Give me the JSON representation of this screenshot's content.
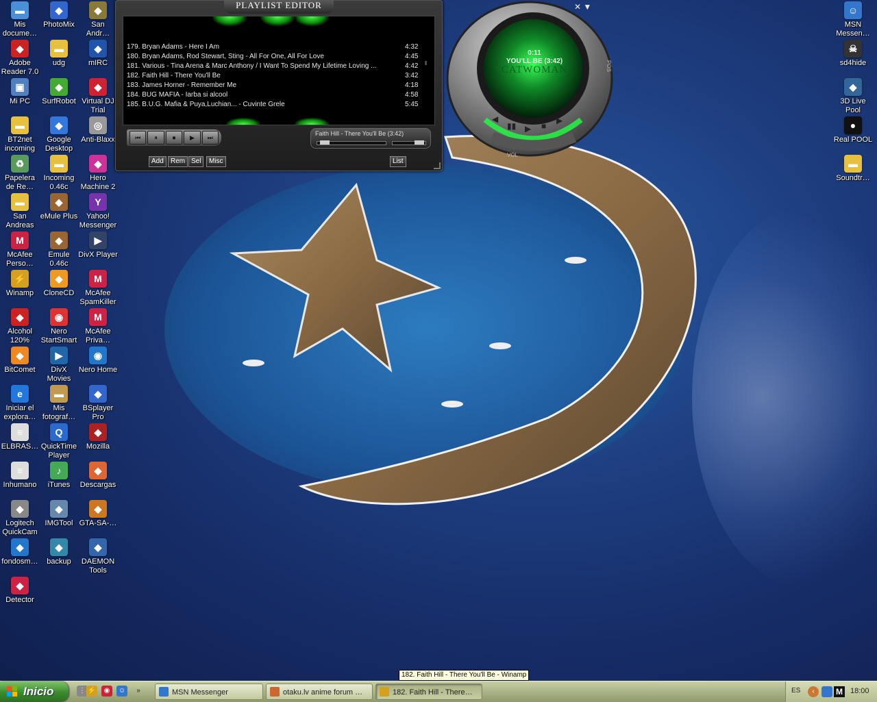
{
  "desktop_icons_left": [
    {
      "label": "Mis documentos",
      "display": "Mis\ndocume…",
      "icon": "folder-icon",
      "color": "#4a90d9"
    },
    {
      "label": "PhotoMix",
      "display": "PhotoMix",
      "icon": "photomix-icon",
      "color": "#3366cc"
    },
    {
      "label": "San Andreas",
      "display": "San\nAndr…",
      "icon": "san-andreas-icon",
      "color": "#8a7a3a"
    },
    {
      "label": "Adobe Reader 7.0",
      "display": "Adobe\nReader 7.0",
      "icon": "adobe-reader-icon",
      "color": "#cc2222"
    },
    {
      "label": "udg",
      "display": "udg",
      "icon": "folder-icon",
      "color": "#e8c040"
    },
    {
      "label": "mIRC",
      "display": "mIRC",
      "icon": "mirc-icon",
      "color": "#2255aa"
    },
    {
      "label": "Mi PC",
      "display": "Mi PC",
      "icon": "computer-icon",
      "color": "#5080c0"
    },
    {
      "label": "SurfRobot",
      "display": "SurfRobot",
      "icon": "surfrobot-icon",
      "color": "#44aa33"
    },
    {
      "label": "Virtual DJ Trial",
      "display": "Virtual DJ\nTrial",
      "icon": "virtual-dj-icon",
      "color": "#cc2233"
    },
    {
      "label": "BT2net incoming",
      "display": "BT2net\nincoming",
      "icon": "folder-icon",
      "color": "#e8c040"
    },
    {
      "label": "Google Desktop",
      "display": "Google\nDesktop",
      "icon": "google-desktop-icon",
      "color": "#3377dd"
    },
    {
      "label": "Anti-Blaxx",
      "display": "Anti-Blaxx",
      "icon": "cd-icon",
      "color": "#999999"
    },
    {
      "label": "Papelera de Reciclaje",
      "display": "Papelera\nde Re…",
      "icon": "recycle-bin-icon",
      "color": "#5a9a5a"
    },
    {
      "label": "Incoming 0.46c",
      "display": "Incoming\n0.46c",
      "icon": "folder-icon",
      "color": "#e8c040"
    },
    {
      "label": "Hero Machine 2",
      "display": "Hero\nMachine 2",
      "icon": "hero-machine-icon",
      "color": "#cc3399"
    },
    {
      "label": "San Andreas",
      "display": "San\nAndreas",
      "icon": "folder-icon",
      "color": "#e8c040"
    },
    {
      "label": "eMule Plus",
      "display": "eMule Plus",
      "icon": "emule-icon",
      "color": "#996633"
    },
    {
      "label": "Yahoo! Messenger",
      "display": "Yahoo!\nMessenger",
      "icon": "yahoo-messenger-icon",
      "color": "#7733aa"
    },
    {
      "label": "McAfee Personal",
      "display": "McAfee\nPerso…",
      "icon": "mcafee-icon",
      "color": "#cc2244"
    },
    {
      "label": "Emule 0.46c",
      "display": "Emule\n0.46c",
      "icon": "emule-icon",
      "color": "#996633"
    },
    {
      "label": "DivX Player",
      "display": "DivX Player",
      "icon": "divx-icon",
      "color": "#334466"
    },
    {
      "label": "Winamp",
      "display": "Winamp",
      "icon": "winamp-icon",
      "color": "#d4a020"
    },
    {
      "label": "CloneCD",
      "display": "CloneCD",
      "icon": "clonecd-icon",
      "color": "#ee9922"
    },
    {
      "label": "McAfee SpamKiller",
      "display": "McAfee\nSpamKiller",
      "icon": "mcafee-icon",
      "color": "#cc2244"
    },
    {
      "label": "Alcohol 120%",
      "display": "Alcohol\n120%",
      "icon": "alcohol-icon",
      "color": "#cc2222"
    },
    {
      "label": "Nero StartSmart",
      "display": "Nero\nStartSmart",
      "icon": "nero-icon",
      "color": "#dd3333"
    },
    {
      "label": "McAfee Privacy",
      "display": "McAfee\nPriva…",
      "icon": "mcafee-icon",
      "color": "#cc2244"
    },
    {
      "label": "BitComet",
      "display": "BitComet",
      "icon": "bitcomet-icon",
      "color": "#ee8822"
    },
    {
      "label": "DivX Movies",
      "display": "DivX\nMovies",
      "icon": "divx-icon",
      "color": "#2266aa"
    },
    {
      "label": "Nero Home",
      "display": "Nero Home",
      "icon": "nero-icon",
      "color": "#2277cc"
    },
    {
      "label": "Iniciar el explorador",
      "display": "Iniciar el\nexplora…",
      "icon": "internet-explorer-icon",
      "color": "#2277dd"
    },
    {
      "label": "Mis fotografías",
      "display": "Mis\nfotograf…",
      "icon": "folder-icon",
      "color": "#c09a50"
    },
    {
      "label": "BSplayer Pro",
      "display": "BSplayer\nPro",
      "icon": "bsplayer-icon",
      "color": "#3366cc"
    },
    {
      "label": "ELBRAS…",
      "display": "ELBRAS…",
      "icon": "document-icon",
      "color": "#dddddd"
    },
    {
      "label": "QuickTime Player",
      "display": "QuickTime\nPlayer",
      "icon": "quicktime-icon",
      "color": "#2a6acc"
    },
    {
      "label": "Mozilla",
      "display": "Mozilla",
      "icon": "mozilla-icon",
      "color": "#aa2222"
    },
    {
      "label": "Inhumano",
      "display": "Inhumano",
      "icon": "document-icon",
      "color": "#dddddd"
    },
    {
      "label": "iTunes",
      "display": "iTunes",
      "icon": "itunes-icon",
      "color": "#44aa55"
    },
    {
      "label": "Descargas",
      "display": "Descargas",
      "icon": "descargas-icon",
      "color": "#dd6633"
    },
    {
      "label": "Logitech QuickCam",
      "display": "Logitech\nQuickCam",
      "icon": "webcam-icon",
      "color": "#888888"
    },
    {
      "label": "IMGTool",
      "display": "IMGTool",
      "icon": "imgtool-icon",
      "color": "#6688aa"
    },
    {
      "label": "GTA-SA-…",
      "display": "GTA-SA-…",
      "icon": "gta-icon",
      "color": "#cc7722"
    },
    {
      "label": "fondosm…",
      "display": "fondosm…",
      "icon": "image-file-icon",
      "color": "#2277cc"
    },
    {
      "label": "backup",
      "display": "backup",
      "icon": "backup-icon",
      "color": "#3388aa"
    },
    {
      "label": "DAEMON Tools",
      "display": "DAEMON\nTools",
      "icon": "daemon-tools-icon",
      "color": "#3366aa"
    },
    {
      "label": "Detector",
      "display": "Detector",
      "icon": "detector-icon",
      "color": "#cc2244"
    }
  ],
  "desktop_icons_right": [
    {
      "label": "MSN Messenger",
      "display": "MSN\nMessen…",
      "icon": "msn-messenger-icon",
      "color": "#3377cc"
    },
    {
      "label": "sd4hide",
      "display": "sd4hide",
      "icon": "skull-icon",
      "color": "#333333"
    },
    {
      "label": "3D Live Pool",
      "display": "3D Live\nPool",
      "icon": "pool-icon",
      "color": "#336699"
    },
    {
      "label": "Real POOL",
      "display": "Real POOL",
      "icon": "pool-ball-icon",
      "color": "#111111"
    },
    {
      "label": "Soundtr…",
      "display": "Soundtr…",
      "icon": "folder-icon",
      "color": "#e8c040"
    }
  ],
  "playlist": {
    "title": "PLAYLIST EDITOR",
    "tracks": [
      {
        "name": "179. Bryan Adams - Here I Am",
        "duration": "4:32"
      },
      {
        "name": "180. Bryan Adams, Rod Stewart, Sting - All For One, All For Love",
        "duration": "4:45"
      },
      {
        "name": "181. Various - Tina Arena & Marc Anthony / I Want To Spend My Lifetime Loving ...",
        "duration": "4:42"
      },
      {
        "name": "182. Faith Hill - There You'll Be",
        "duration": "3:42"
      },
      {
        "name": "183. James Horner - Remember Me",
        "duration": "4:18"
      },
      {
        "name": "184. BUG MAFIA - Iarba si alcool",
        "duration": "4:58"
      },
      {
        "name": "185. B.U.G. Mafia & Puya,Luchian... - Cuvinte Grele",
        "duration": "5:45"
      }
    ],
    "now_playing": "Faith Hill - There You'll Be (3:42)",
    "buttons": {
      "add": "Add",
      "rem": "Rem",
      "sel": "Sel",
      "misc": "Misc",
      "list": "List"
    },
    "controls": [
      "⏮",
      "⏸",
      "⏹",
      "▶",
      "⏭"
    ]
  },
  "player": {
    "time": "0:11",
    "song": "YOU'LL BE (3:42)",
    "skin_title": "CATWOMAN",
    "vol_label": "VOL",
    "pos_label": "POS"
  },
  "taskbar": {
    "start_label": "Inicio",
    "tasks": [
      {
        "label": "MSN Messenger",
        "icon_color": "#3377cc",
        "active": false
      },
      {
        "label": "otaku.lv anime forum …",
        "icon_color": "#cc6633",
        "active": false
      },
      {
        "label": "182. Faith Hill - There…",
        "icon_color": "#d4a020",
        "active": true
      }
    ],
    "language": "ES",
    "clock": "18:00"
  },
  "tooltip": "182. Faith Hill - There You'll Be - Winamp"
}
